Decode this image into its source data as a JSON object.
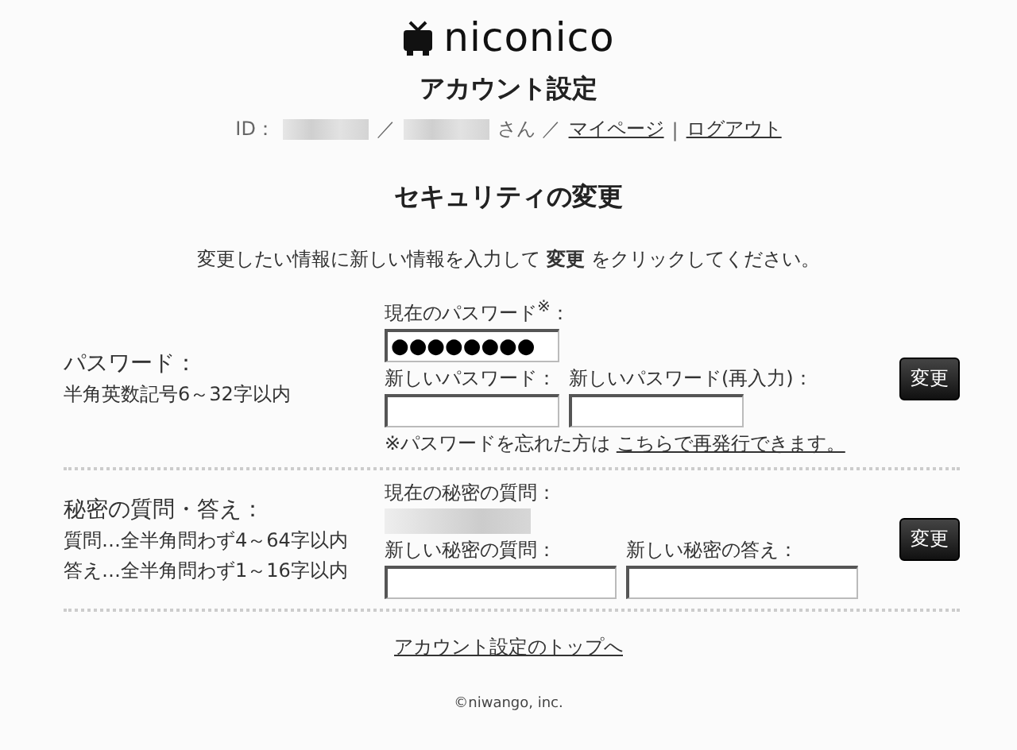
{
  "logo": {
    "text": "niconico"
  },
  "page_title": "アカウント設定",
  "user_bar": [
    {
      "kind": "text",
      "text": "ID："
    },
    {
      "kind": "redacted"
    },
    {
      "kind": "text",
      "text": "／"
    },
    {
      "kind": "redacted"
    },
    {
      "kind": "text",
      "text": "さん ／"
    },
    {
      "kind": "link",
      "text": "マイページ"
    },
    {
      "kind": "text",
      "text": "|"
    },
    {
      "kind": "link",
      "text": "ログアウト"
    }
  ],
  "section_title": "セキュリティの変更",
  "instruction": "変更したい情報に新しい情報を入力して **変更** をクリックしてください。",
  "sections": [
    {
      "label": "パスワード：",
      "notes": [
        "半角英数記号6～32字以内"
      ],
      "current_label": "現在のパスワード$^{※}$：",
      "current": {
        "kind": "field",
        "value": "●●●●●●●●"
      },
      "new_fields": [
        {
          "label": "新しいパスワード："
        },
        {
          "label": "新しいパスワード(再入力)："
        }
      ],
      "button": "変更",
      "footnote": {
        "text": "※パスワードを忘れた方は",
        "link": "こちらで再発行できます。"
      }
    },
    {
      "label": "秘密の質問・答え：",
      "notes": [
        "質問…全半角問わず4～64字以内",
        "答え…全半角問わず1～16字以内"
      ],
      "current_label": "現在の秘密の質問：",
      "current": {
        "kind": "redacted"
      },
      "new_fields": [
        {
          "label": "新しい秘密の質問："
        },
        {
          "label": "新しい秘密の答え："
        }
      ],
      "button": "変更"
    }
  ],
  "bottom_link": "アカウント設定のトップへ",
  "copyright": "©niwango, inc."
}
